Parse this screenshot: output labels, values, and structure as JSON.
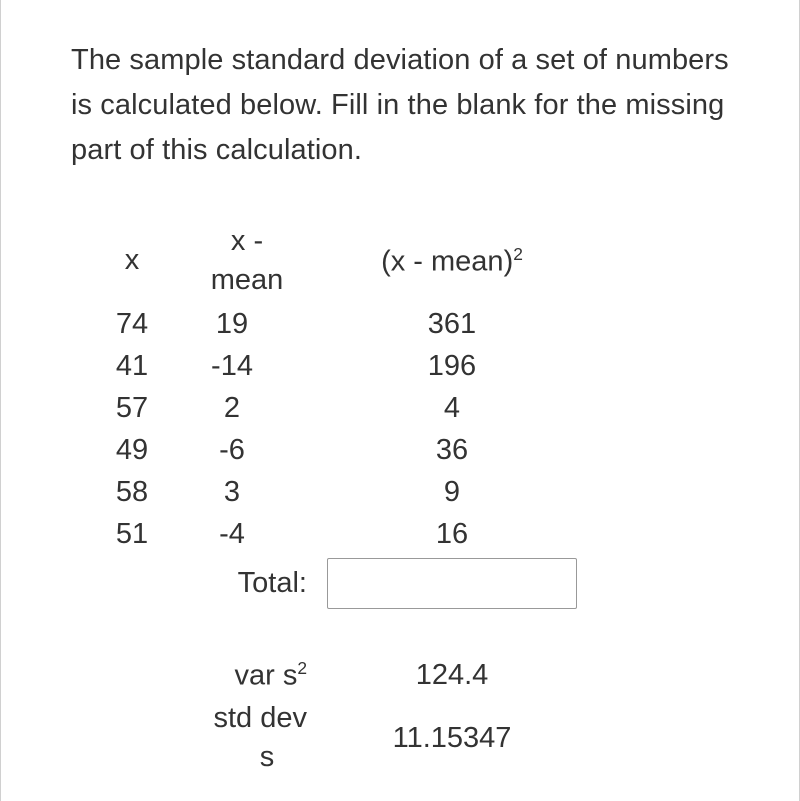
{
  "prompt": "The sample standard deviation of a set of numbers is calculated below. Fill in the blank for the missing part of this calculation.",
  "headers": {
    "x": "x",
    "xmean_line1": "x -",
    "xmean_line2": "mean",
    "sq_prefix": "(x - mean)",
    "sq_exp": "2"
  },
  "rows": [
    {
      "x": "74",
      "xmean": "19",
      "sq": "361"
    },
    {
      "x": "41",
      "xmean": "-14",
      "sq": "196"
    },
    {
      "x": "57",
      "xmean": "2",
      "sq": "4"
    },
    {
      "x": "49",
      "xmean": "-6",
      "sq": "36"
    },
    {
      "x": "58",
      "xmean": "3",
      "sq": "9"
    },
    {
      "x": "51",
      "xmean": "-4",
      "sq": "16"
    }
  ],
  "total_label": "Total:",
  "total_value": "",
  "var_label_prefix": "var s",
  "var_label_exp": "2",
  "var_value": "124.4",
  "stddev_label_line1": "std dev",
  "stddev_label_line2": "s",
  "stddev_value": "11.15347"
}
